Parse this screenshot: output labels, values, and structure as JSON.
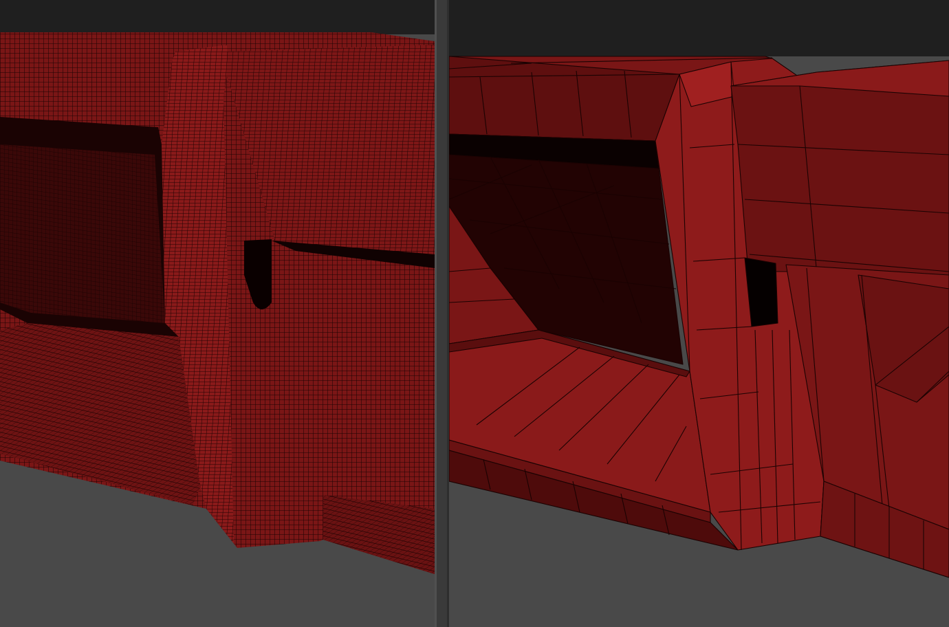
{
  "layout": {
    "viewports": [
      {
        "id": "left",
        "shading": "wireframe-on-shaded",
        "mesh_density": "high-poly"
      },
      {
        "id": "right",
        "shading": "wireframe-on-shaded",
        "mesh_density": "low-poly"
      }
    ]
  },
  "colors": {
    "background_top": "#1e1e1e",
    "background_bottom": "#494949",
    "mesh_base": "#7a1616",
    "mesh_dark": "#4a0c0c",
    "mesh_light": "#8e1b1b",
    "mesh_shadow": "#120303",
    "wire": "#1a0202",
    "divider": "#3a3a3a"
  }
}
